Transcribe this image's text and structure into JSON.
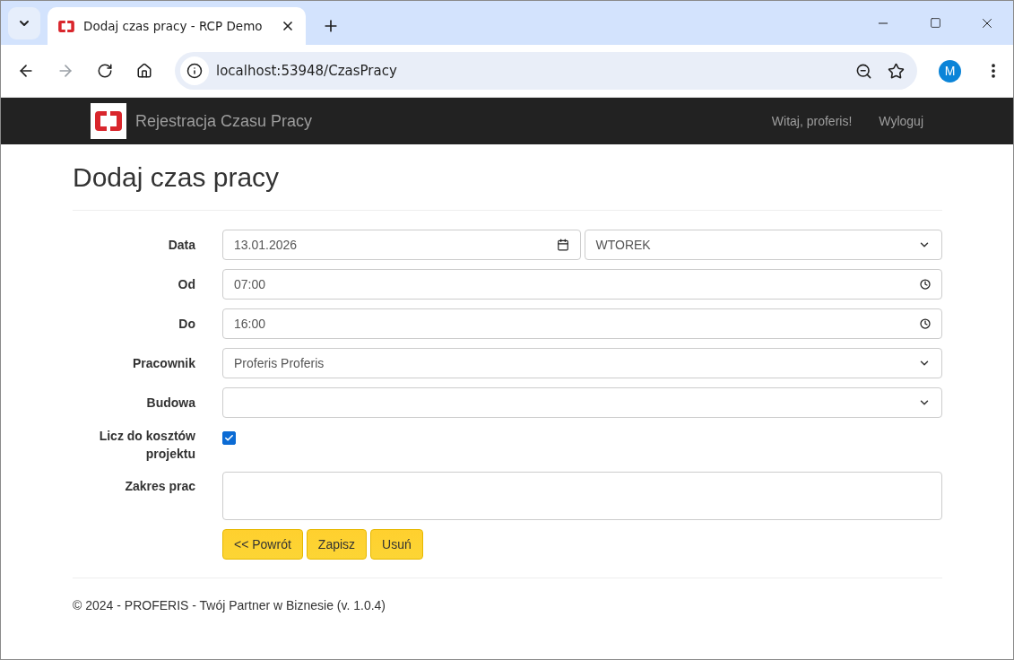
{
  "browser": {
    "tab_title": "Dodaj czas pracy - RCP Demo",
    "address": "localhost:53948/CzasPracy",
    "profile_initial": "M"
  },
  "navbar": {
    "brand": "Rejestracja Czasu Pracy",
    "links": [
      "Witaj, proferis!",
      "Wyloguj"
    ]
  },
  "page": {
    "title": "Dodaj czas pracy"
  },
  "form": {
    "rows": [
      {
        "kind": "date",
        "label": "Data",
        "value": "13.01.2026",
        "day": "WTOREK"
      },
      {
        "kind": "time",
        "label": "Od",
        "value": "07:00"
      },
      {
        "kind": "time",
        "label": "Do",
        "value": "16:00"
      },
      {
        "kind": "select",
        "label": "Pracownik",
        "value": "Proferis Proferis"
      },
      {
        "kind": "select",
        "label": "Budowa"
      },
      {
        "kind": "checkbox",
        "label": "Licz do kosztów projektu",
        "checked": true
      },
      {
        "kind": "textarea",
        "label": "Zakres prac"
      }
    ]
  },
  "buttons": [
    "<< Powrót",
    "Zapisz",
    "Usuń"
  ],
  "footer": "© 2024 - PROFERIS - Twój Partner w Biznesie (v. 1.0.4)"
}
